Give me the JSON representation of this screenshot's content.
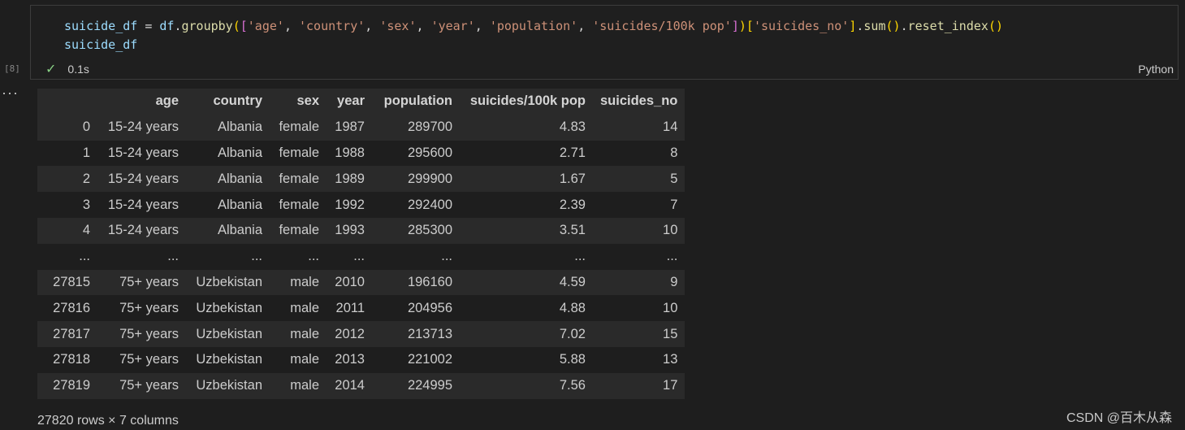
{
  "cell": {
    "execution_count": "[8]",
    "code_lines": [
      [
        {
          "t": "suicide_df",
          "c": "tk-var"
        },
        {
          "t": " = ",
          "c": ""
        },
        {
          "t": "df",
          "c": "tk-var"
        },
        {
          "t": ".",
          "c": ""
        },
        {
          "t": "groupby",
          "c": "tk-fn"
        },
        {
          "t": "(",
          "c": "tk-b1"
        },
        {
          "t": "[",
          "c": "tk-b2"
        },
        {
          "t": "'age'",
          "c": "tk-str"
        },
        {
          "t": ", ",
          "c": ""
        },
        {
          "t": "'country'",
          "c": "tk-str"
        },
        {
          "t": ", ",
          "c": ""
        },
        {
          "t": "'sex'",
          "c": "tk-str"
        },
        {
          "t": ", ",
          "c": ""
        },
        {
          "t": "'year'",
          "c": "tk-str"
        },
        {
          "t": ", ",
          "c": ""
        },
        {
          "t": "'population'",
          "c": "tk-str"
        },
        {
          "t": ", ",
          "c": ""
        },
        {
          "t": "'suicides/100k pop'",
          "c": "tk-str"
        },
        {
          "t": "]",
          "c": "tk-b2"
        },
        {
          "t": ")",
          "c": "tk-b1"
        },
        {
          "t": "[",
          "c": "tk-b1"
        },
        {
          "t": "'suicides_no'",
          "c": "tk-str"
        },
        {
          "t": "]",
          "c": "tk-b1"
        },
        {
          "t": ".",
          "c": ""
        },
        {
          "t": "sum",
          "c": "tk-fn"
        },
        {
          "t": "()",
          "c": "tk-b1"
        },
        {
          "t": ".",
          "c": ""
        },
        {
          "t": "reset_index",
          "c": "tk-fn"
        },
        {
          "t": "()",
          "c": "tk-b1"
        }
      ],
      [
        {
          "t": "suicide_df",
          "c": "tk-var"
        }
      ]
    ],
    "status_icon": "check-icon",
    "duration": "0.1s",
    "language": "Python"
  },
  "output": {
    "more_glyph": "···",
    "columns": [
      "",
      "age",
      "country",
      "sex",
      "year",
      "population",
      "suicides/100k pop",
      "suicides_no"
    ],
    "rows": [
      [
        "0",
        "15-24 years",
        "Albania",
        "female",
        "1987",
        "289700",
        "4.83",
        "14"
      ],
      [
        "1",
        "15-24 years",
        "Albania",
        "female",
        "1988",
        "295600",
        "2.71",
        "8"
      ],
      [
        "2",
        "15-24 years",
        "Albania",
        "female",
        "1989",
        "299900",
        "1.67",
        "5"
      ],
      [
        "3",
        "15-24 years",
        "Albania",
        "female",
        "1992",
        "292400",
        "2.39",
        "7"
      ],
      [
        "4",
        "15-24 years",
        "Albania",
        "female",
        "1993",
        "285300",
        "3.51",
        "10"
      ],
      [
        "...",
        "...",
        "...",
        "...",
        "...",
        "...",
        "...",
        "..."
      ],
      [
        "27815",
        "75+ years",
        "Uzbekistan",
        "male",
        "2010",
        "196160",
        "4.59",
        "9"
      ],
      [
        "27816",
        "75+ years",
        "Uzbekistan",
        "male",
        "2011",
        "204956",
        "4.88",
        "10"
      ],
      [
        "27817",
        "75+ years",
        "Uzbekistan",
        "male",
        "2012",
        "213713",
        "7.02",
        "15"
      ],
      [
        "27818",
        "75+ years",
        "Uzbekistan",
        "male",
        "2013",
        "221002",
        "5.88",
        "13"
      ],
      [
        "27819",
        "75+ years",
        "Uzbekistan",
        "male",
        "2014",
        "224995",
        "7.56",
        "17"
      ]
    ],
    "shape_text": "27820 rows × 7 columns"
  },
  "watermark": "CSDN @百木从森",
  "colors": {
    "background": "#1e1e1e",
    "check": "#89d185",
    "string": "#ce9178",
    "function": "#dcdcaa",
    "variable": "#9cdcfe"
  }
}
